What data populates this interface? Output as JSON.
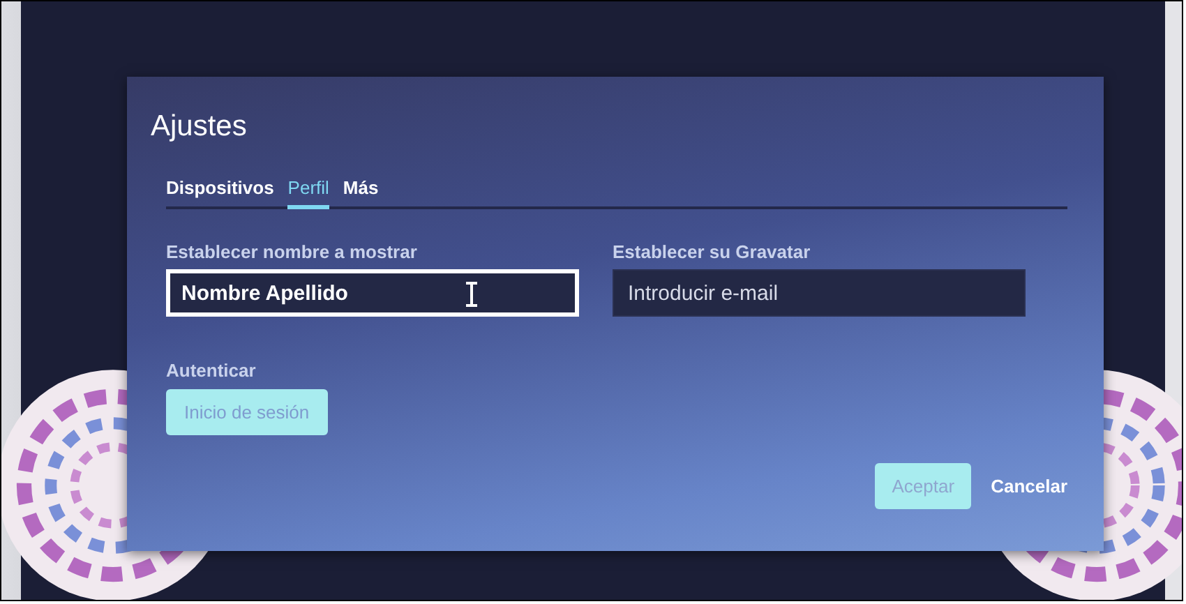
{
  "dialog": {
    "title": "Ajustes",
    "tabs": [
      {
        "label": "Dispositivos",
        "selected": false
      },
      {
        "label": "Perfil",
        "selected": true
      },
      {
        "label": "Más",
        "selected": false
      }
    ],
    "fields": [
      {
        "label": "Establecer nombre a mostrar",
        "value": "Nombre Apellido",
        "focused": true
      },
      {
        "label": "Establecer su Gravatar",
        "placeholder": "Introducir e-mail",
        "focused": false
      }
    ],
    "auth": {
      "label": "Autenticar",
      "button": "Inicio de sesión"
    },
    "buttons": [
      {
        "label": "Aceptar",
        "kind": "filled"
      },
      {
        "label": "Cancelar",
        "kind": "plain"
      }
    ]
  }
}
